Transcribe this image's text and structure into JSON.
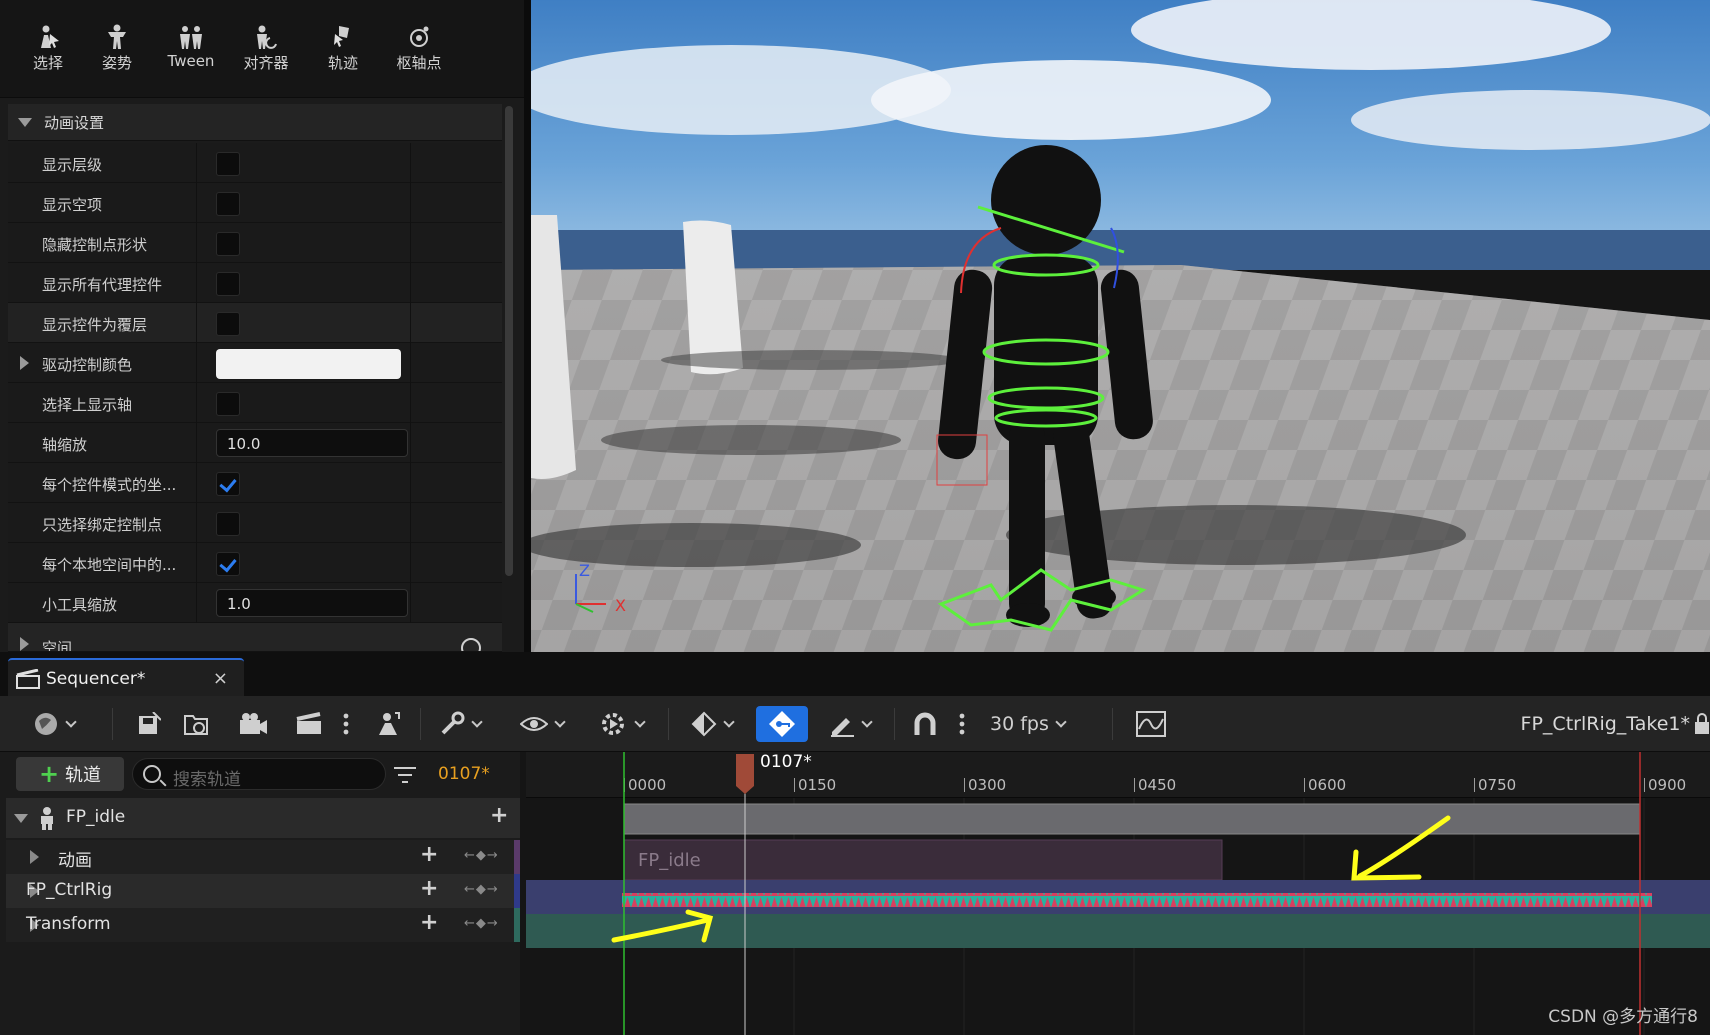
{
  "mode_toolbar": {
    "items": [
      {
        "label": "选择",
        "icon": "select-icon"
      },
      {
        "label": "姿势",
        "icon": "pose-icon"
      },
      {
        "label": "Tween",
        "icon": "tween-icon"
      },
      {
        "label": "对齐器",
        "icon": "snapper-icon"
      },
      {
        "label": "轨迹",
        "icon": "trail-icon"
      },
      {
        "label": "枢轴点",
        "icon": "pivot-icon"
      }
    ]
  },
  "details": {
    "category_title": "动画设置",
    "rows": [
      {
        "label": "显示层级",
        "type": "checkbox",
        "checked": false
      },
      {
        "label": "显示空项",
        "type": "checkbox",
        "checked": false
      },
      {
        "label": "隐藏控制点形状",
        "type": "checkbox",
        "checked": false
      },
      {
        "label": "显示所有代理控件",
        "type": "checkbox",
        "checked": false
      },
      {
        "label": "显示控件为覆层",
        "type": "checkbox",
        "checked": false
      },
      {
        "label": "驱动控制颜色",
        "type": "color",
        "color": "#f2f2f2"
      },
      {
        "label": "选择上显示轴",
        "type": "checkbox",
        "checked": false
      },
      {
        "label": "轴缩放",
        "type": "number",
        "value": "10.0"
      },
      {
        "label": "每个控件模式的坐...",
        "type": "checkbox",
        "checked": true
      },
      {
        "label": "只选择绑定控制点",
        "type": "checkbox",
        "checked": false
      },
      {
        "label": "每个本地空间中的...",
        "type": "checkbox",
        "checked": true
      },
      {
        "label": "小工具缩放",
        "type": "number",
        "value": "1.0"
      }
    ],
    "next_category_partial": "空间"
  },
  "viewport": {
    "axis_labels": {
      "z": "Z",
      "x": "X"
    }
  },
  "sequencer": {
    "tab_title": "Sequencer*",
    "close_label": "×",
    "fps_label": "30 fps",
    "sequence_name": "FP_CtrlRig_Take1*",
    "add_track_label": "轨道",
    "search_placeholder": "搜索轨道",
    "current_frame": "0107*",
    "playhead_label": "0107*",
    "tracks": [
      {
        "label": "FP_idle",
        "level": 0,
        "stripe": "#1b1b1b"
      },
      {
        "label": "动画",
        "level": 1,
        "stripe": "#5a3a6a"
      },
      {
        "label": "FP_CtrlRig",
        "level": 1,
        "stripe": "#2f3a8a"
      },
      {
        "label": "Transform",
        "level": 1,
        "stripe": "#2e6a5e"
      }
    ],
    "ruler": [
      "0000",
      "0150",
      "0300",
      "0450",
      "0600",
      "0750",
      "0900"
    ],
    "clip_label": "FP_idle",
    "colors": {
      "accent_blue": "#1f6fe0",
      "ctrlrig_lane": "#3a3f6e",
      "transform_lane": "#2f5a52",
      "keyframe_teal": "#27b3a0",
      "keyframe_red": "#d84060",
      "annotation_yellow": "#ffff1a"
    }
  },
  "watermark": "CSDN @多方通行8"
}
